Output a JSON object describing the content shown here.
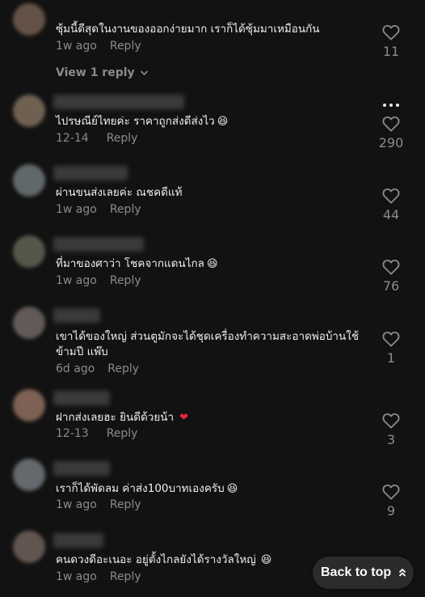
{
  "colors": {
    "background": "#121212",
    "text": "#eeeeee",
    "muted": "#8a8b91",
    "heart_red": "#e8263a",
    "button_bg": "#2b2b2b"
  },
  "comments": [
    {
      "text": "ซุ้มนี้ดีสุดในงานของออกง่ายมาก เราก็ได้ซุ้มมาเหมือนกัน",
      "time": "1w ago",
      "reply": "Reply",
      "likes": "11",
      "view_replies": "View 1 reply"
    },
    {
      "text": "ไปรษณีย์ไทยค่ะ ราคาถูกส่งดีส่งไว",
      "emoji": "😆",
      "time": "12-14",
      "reply": "Reply",
      "likes": "290"
    },
    {
      "text": "ผ่านขนส่งเลยค่ะ ณชคดีแท้",
      "time": "1w ago",
      "reply": "Reply",
      "likes": "44"
    },
    {
      "text": "ที่มาของศาว่า โชคจากแดนไกล",
      "emoji": "😆",
      "time": "1w ago",
      "reply": "Reply",
      "likes": "76"
    },
    {
      "text": "เขาได้ของใหญ่ ส่วนตูมักจะได้ชุดเครื่องทำความสะอาดพ่อบ้านใช้ข้ามปี แพ๊บ",
      "time": "6d ago",
      "reply": "Reply",
      "likes": "1"
    },
    {
      "text": "ฝากส่งเลยฮะ ยินดีด้วยน้า",
      "emoji": "❤",
      "time": "12-13",
      "reply": "Reply",
      "likes": "3"
    },
    {
      "text": "เราก็ได้พัดลม ค่าส่ง100บาทเองครับ",
      "emoji": "😆",
      "time": "1w ago",
      "reply": "Reply",
      "likes": "9"
    },
    {
      "text": "คนดวงดีอะเนอะ อยู่ตั้งไกลยังได้รางวัลใหญ่",
      "emoji": "😆",
      "time": "1w ago",
      "reply": "Reply"
    }
  ],
  "back_to_top": {
    "label": "Back to top",
    "icon": "double-chevron-up-icon"
  }
}
